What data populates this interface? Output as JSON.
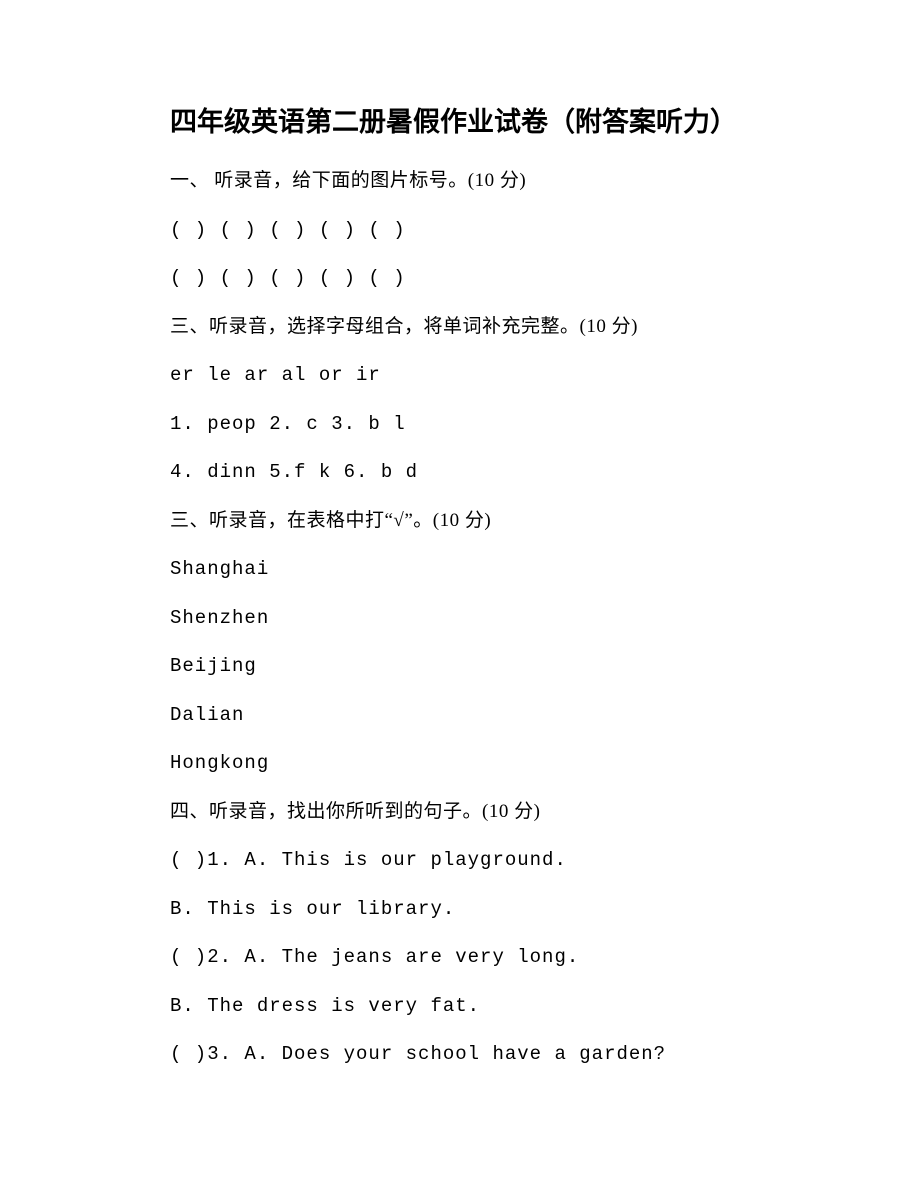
{
  "title": "四年级英语第二册暑假作业试卷（附答案听力）",
  "lines": {
    "l1": "一、 听录音，给下面的图片标号。(10 分)",
    "l2": "( )  ( )  ( )  ( )  ( )",
    "l3": "( )  ( )  ( )  ( )  ( )",
    "l4": "三、听录音，选择字母组合，将单词补充完整。(10 分)",
    "l5": "er le ar al or ir",
    "l6": "1. peop 2. c 3. b l",
    "l7": "4. dinn 5.f k 6. b d",
    "l8": "三、听录音，在表格中打“√”。(10 分)",
    "l9": "Shanghai",
    "l10": "Shenzhen",
    "l11": "Beijing",
    "l12": "Dalian",
    "l13": "Hongkong",
    "l14": "四、听录音，找出你所听到的句子。(10 分)",
    "l15": "( )1. A. This is our playground.",
    "l16": "B. This is our library.",
    "l17": "( )2. A. The jeans are very long.",
    "l18": "B. The dress is very fat.",
    "l19": "( )3. A. Does your school have a garden?"
  }
}
